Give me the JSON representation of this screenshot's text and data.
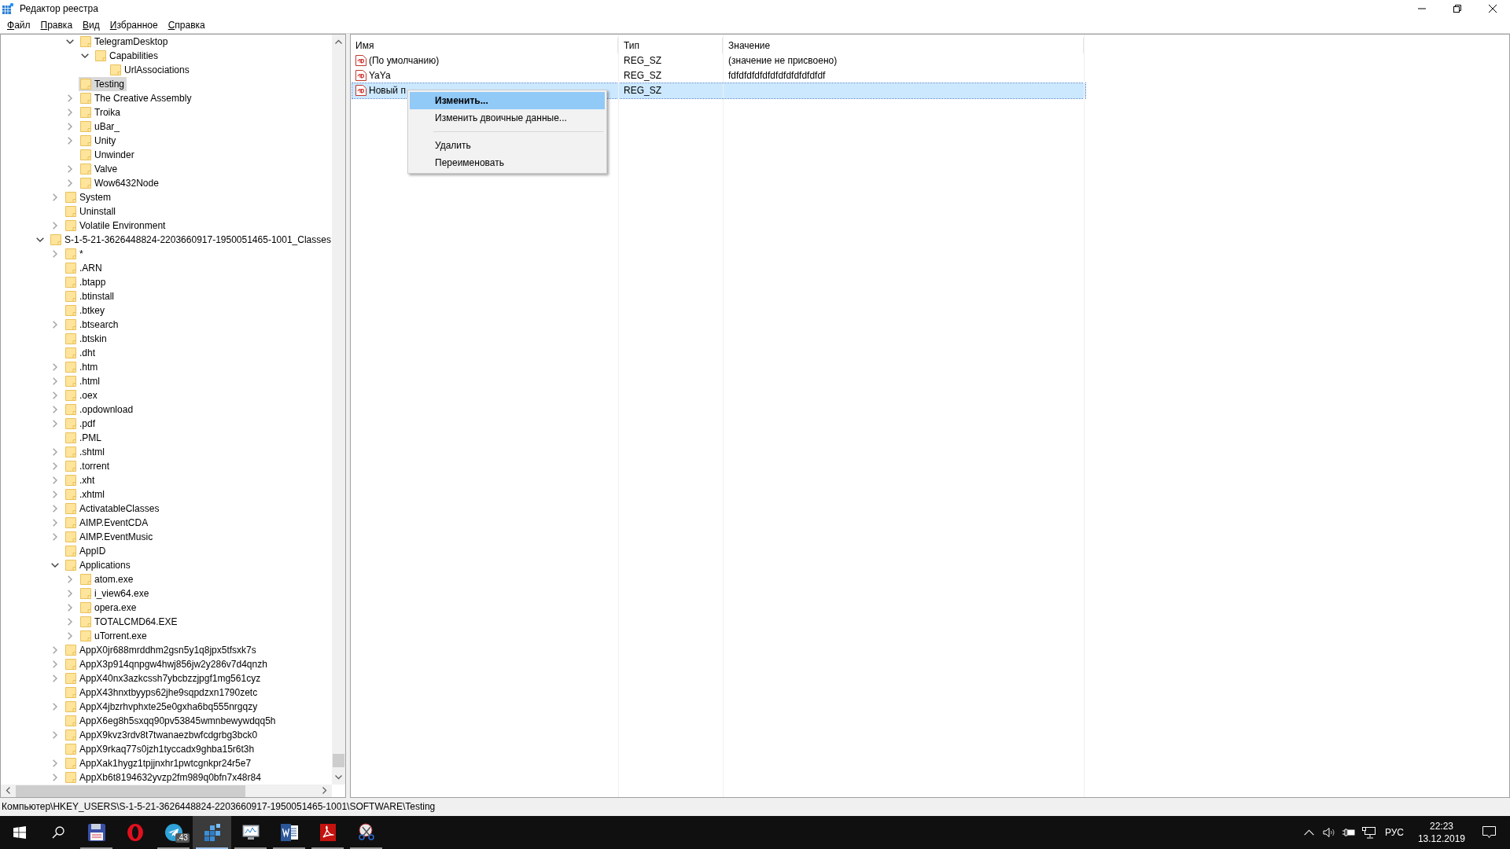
{
  "window": {
    "title": "Редактор реестра"
  },
  "menu": [
    "Файл",
    "Правка",
    "Вид",
    "Избранное",
    "Справка"
  ],
  "tree": {
    "items": [
      {
        "children": [
          {
            "children": [
              {
                "label": "TelegramDesktop",
                "has_children": true,
                "expanded": true,
                "selected": false,
                "children": [
                  {
                    "label": "Capabilities",
                    "has_children": true,
                    "expanded": true,
                    "selected": false,
                    "children": [
                      {
                        "label": "UrlAssociations",
                        "has_children": false,
                        "expanded": false,
                        "selected": false
                      }
                    ]
                  }
                ]
              },
              {
                "label": "Testing",
                "has_children": false,
                "expanded": false,
                "selected": true
              },
              {
                "label": "The Creative Assembly",
                "has_children": true,
                "expanded": false,
                "selected": false
              },
              {
                "label": "Troika",
                "has_children": true,
                "expanded": false,
                "selected": false
              },
              {
                "label": "uBar_",
                "has_children": true,
                "expanded": false,
                "selected": false
              },
              {
                "label": "Unity",
                "has_children": true,
                "expanded": false,
                "selected": false
              },
              {
                "label": "Unwinder",
                "has_children": false,
                "expanded": false,
                "selected": false
              },
              {
                "label": "Valve",
                "has_children": true,
                "expanded": false,
                "selected": false
              },
              {
                "label": "Wow6432Node",
                "has_children": true,
                "expanded": false,
                "selected": false
              }
            ]
          },
          {
            "label": "System",
            "has_children": true,
            "expanded": false,
            "selected": false
          },
          {
            "label": "Uninstall",
            "has_children": false,
            "expanded": false,
            "selected": false
          },
          {
            "label": "Volatile Environment",
            "has_children": true,
            "expanded": false,
            "selected": false
          }
        ]
      },
      {
        "label": "S-1-5-21-3626448824-2203660917-1950051465-1001_Classes",
        "has_children": true,
        "expanded": true,
        "selected": false,
        "children": [
          {
            "label": "*",
            "has_children": true,
            "expanded": false,
            "selected": false
          },
          {
            "label": ".ARN",
            "has_children": false,
            "expanded": false,
            "selected": false
          },
          {
            "label": ".btapp",
            "has_children": false,
            "expanded": false,
            "selected": false
          },
          {
            "label": ".btinstall",
            "has_children": false,
            "expanded": false,
            "selected": false
          },
          {
            "label": ".btkey",
            "has_children": false,
            "expanded": false,
            "selected": false
          },
          {
            "label": ".btsearch",
            "has_children": true,
            "expanded": false,
            "selected": false
          },
          {
            "label": ".btskin",
            "has_children": false,
            "expanded": false,
            "selected": false
          },
          {
            "label": ".dht",
            "has_children": false,
            "expanded": false,
            "selected": false
          },
          {
            "label": ".htm",
            "has_children": true,
            "expanded": false,
            "selected": false
          },
          {
            "label": ".html",
            "has_children": true,
            "expanded": false,
            "selected": false
          },
          {
            "label": ".oex",
            "has_children": true,
            "expanded": false,
            "selected": false
          },
          {
            "label": ".opdownload",
            "has_children": true,
            "expanded": false,
            "selected": false
          },
          {
            "label": ".pdf",
            "has_children": true,
            "expanded": false,
            "selected": false
          },
          {
            "label": ".PML",
            "has_children": false,
            "expanded": false,
            "selected": false
          },
          {
            "label": ".shtml",
            "has_children": true,
            "expanded": false,
            "selected": false
          },
          {
            "label": ".torrent",
            "has_children": true,
            "expanded": false,
            "selected": false
          },
          {
            "label": ".xht",
            "has_children": true,
            "expanded": false,
            "selected": false
          },
          {
            "label": ".xhtml",
            "has_children": true,
            "expanded": false,
            "selected": false
          },
          {
            "label": "ActivatableClasses",
            "has_children": true,
            "expanded": false,
            "selected": false
          },
          {
            "label": "AIMP.EventCDA",
            "has_children": true,
            "expanded": false,
            "selected": false
          },
          {
            "label": "AIMP.EventMusic",
            "has_children": true,
            "expanded": false,
            "selected": false
          },
          {
            "label": "AppID",
            "has_children": false,
            "expanded": false,
            "selected": false
          },
          {
            "label": "Applications",
            "has_children": true,
            "expanded": true,
            "selected": false,
            "children": [
              {
                "label": "atom.exe",
                "has_children": true,
                "expanded": false,
                "selected": false
              },
              {
                "label": "i_view64.exe",
                "has_children": true,
                "expanded": false,
                "selected": false
              },
              {
                "label": "opera.exe",
                "has_children": true,
                "expanded": false,
                "selected": false
              },
              {
                "label": "TOTALCMD64.EXE",
                "has_children": true,
                "expanded": false,
                "selected": false
              },
              {
                "label": "uTorrent.exe",
                "has_children": true,
                "expanded": false,
                "selected": false
              }
            ]
          },
          {
            "label": "AppX0jr688mrddhm2gsn5y1q8jpx5tfsxk7s",
            "has_children": true,
            "expanded": false,
            "selected": false
          },
          {
            "label": "AppX3p914qnpgw4hwj856jw2y286v7d4qnzh",
            "has_children": true,
            "expanded": false,
            "selected": false
          },
          {
            "label": "AppX40nx3azkcssh7ybcbzzjpgf1mg561cyz",
            "has_children": true,
            "expanded": false,
            "selected": false
          },
          {
            "label": "AppX43hnxtbyyps62jhe9sqpdzxn1790zetc",
            "has_children": false,
            "expanded": false,
            "selected": false
          },
          {
            "label": "AppX4jbzrhvphxte25e0gxha6bq555nrgqzy",
            "has_children": true,
            "expanded": false,
            "selected": false
          },
          {
            "label": "AppX6eg8h5sxqq90pv53845wmnbewywdqq5h",
            "has_children": false,
            "expanded": false,
            "selected": false
          },
          {
            "label": "AppX9kvz3rdv8t7twanaezbwfcdgrbg3bck0",
            "has_children": true,
            "expanded": false,
            "selected": false
          },
          {
            "label": "AppX9rkaq77s0jzh1tyccadx9ghba15r6t3h",
            "has_children": false,
            "expanded": false,
            "selected": false
          },
          {
            "label": "AppXak1hygz1tpjjnxhr1pwtcgnkpr24r5e7",
            "has_children": true,
            "expanded": false,
            "selected": false
          },
          {
            "label": "AppXb6t8194632yvzp2fm989q0bfn7x48r84",
            "has_children": true,
            "expanded": false,
            "selected": false
          }
        ]
      }
    ]
  },
  "values": {
    "columns": [
      "Имя",
      "Тип",
      "Значение"
    ],
    "rows": [
      {
        "name": "(По умолчанию)",
        "type": "REG_SZ",
        "value": "(значение не присвоено)",
        "selected": false
      },
      {
        "name": "YaYa",
        "type": "REG_SZ",
        "value": "fdfdfdfdfdfdfdfdfdfdfdfdf",
        "selected": false
      },
      {
        "name": "Новый п",
        "type": "REG_SZ",
        "selected": true
      }
    ]
  },
  "context_menu": {
    "items": [
      {
        "kind": "item",
        "label": "Изменить...",
        "selected": true
      },
      {
        "kind": "item",
        "label": "Изменить двоичные данные...",
        "selected": false
      },
      {
        "kind": "separator"
      },
      {
        "kind": "item",
        "label": "Удалить",
        "selected": false
      },
      {
        "kind": "item",
        "label": "Переименовать",
        "selected": false
      }
    ]
  },
  "status_bar": "Компьютер\\HKEY_USERS\\S-1-5-21-3626448824-2203660917-1950051465-1001\\SOFTWARE\\Testing",
  "taskbar": {
    "apps": [
      {
        "kind": "floppy",
        "running": true,
        "active": false
      },
      {
        "kind": "opera",
        "running": false,
        "active": false
      },
      {
        "kind": "telegram",
        "running": true,
        "active": false,
        "badge": ".43"
      },
      {
        "kind": "regedit",
        "running": true,
        "active": true
      },
      {
        "kind": "monitor",
        "running": true,
        "active": false
      },
      {
        "kind": "word",
        "running": true,
        "active": false
      },
      {
        "kind": "acrobat",
        "running": true,
        "active": false
      },
      {
        "kind": "scissors",
        "running": true,
        "active": false
      }
    ],
    "language": "РУС",
    "time": "22:23",
    "date": "13.12.2019"
  }
}
